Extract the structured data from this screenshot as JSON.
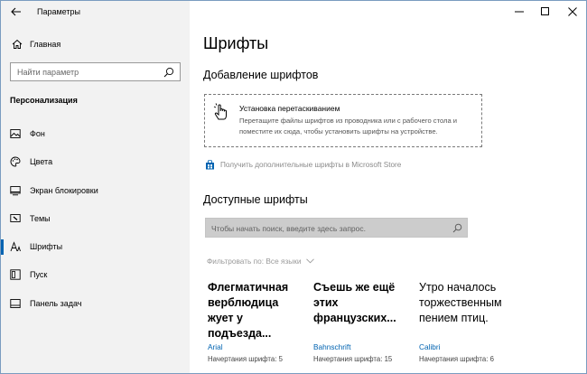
{
  "window": {
    "title": "Параметры",
    "controls": [
      "minimize",
      "maximize",
      "close"
    ]
  },
  "sidebar": {
    "home_label": "Главная",
    "search_placeholder": "Найти параметр",
    "section_title": "Персонализация",
    "items": [
      {
        "label": "Фон",
        "icon": "image-icon"
      },
      {
        "label": "Цвета",
        "icon": "palette-icon"
      },
      {
        "label": "Экран блокировки",
        "icon": "lock-screen-icon"
      },
      {
        "label": "Темы",
        "icon": "brush-icon"
      },
      {
        "label": "Шрифты",
        "icon": "font-icon",
        "active": true
      },
      {
        "label": "Пуск",
        "icon": "start-icon"
      },
      {
        "label": "Панель задач",
        "icon": "taskbar-icon"
      }
    ]
  },
  "main": {
    "title": "Шрифты",
    "add_section": {
      "heading": "Добавление шрифтов",
      "drop_title": "Установка перетаскиванием",
      "drop_desc": "Перетащите файлы шрифтов из проводника или с рабочего стола и поместите их сюда, чтобы установить шрифты на устройстве.",
      "store_link": "Получить дополнительные шрифты в Microsoft Store"
    },
    "available_section": {
      "heading": "Доступные шрифты",
      "search_placeholder": "Чтобы начать поиск, введите здесь запрос.",
      "filter_label": "Фильтровать по:",
      "filter_value": "Все языки",
      "fonts": [
        {
          "preview": "Флегматичная верблюдица жует у подъезда...",
          "name": "Arial",
          "meta": "Начертания шрифта: 5"
        },
        {
          "preview": "Съешь же ещё этих французских...",
          "name": "Bahnschrift",
          "meta": "Начертания шрифта: 15"
        },
        {
          "preview": "Утро началось торжественным пением птиц.",
          "name": "Calibri",
          "meta": "Начертания шрифта: 6"
        }
      ]
    }
  },
  "colors": {
    "accent": "#0063b1",
    "sidebar_bg": "#f2f2f2",
    "search_bg": "#cccccc"
  }
}
